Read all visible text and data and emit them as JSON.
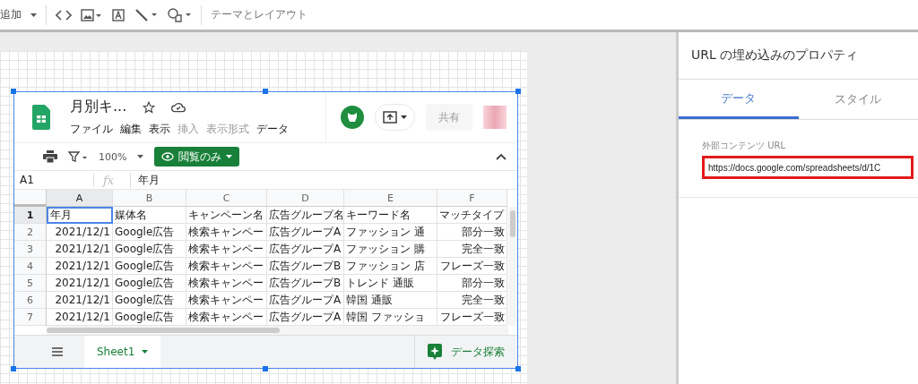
{
  "toolbar": {
    "add_label": "追加",
    "theme_button": "テーマとレイアウト"
  },
  "sheet": {
    "title": "月別キ...",
    "menu": [
      {
        "label": "ファイル",
        "disabled": false
      },
      {
        "label": "編集",
        "disabled": false
      },
      {
        "label": "表示",
        "disabled": false
      },
      {
        "label": "挿入",
        "disabled": true
      },
      {
        "label": "表示形式",
        "disabled": true
      },
      {
        "label": "データ",
        "disabled": false
      }
    ],
    "share_button": {
      "label": "共有",
      "disabled": true
    },
    "zoom": "100%",
    "view_mode": "閲覧のみ",
    "cell_ref": "A1",
    "function_label": "fx",
    "formula": "年月",
    "columns": [
      {
        "label": "A",
        "selected": true,
        "right_aligned": true
      },
      {
        "label": "B",
        "selected": false,
        "right_aligned": false
      },
      {
        "label": "C",
        "selected": false,
        "right_aligned": false
      },
      {
        "label": "D",
        "selected": false,
        "right_aligned": false
      },
      {
        "label": "E",
        "selected": false,
        "right_aligned": false
      },
      {
        "label": "F",
        "selected": false,
        "right_aligned": true
      }
    ],
    "rows": [
      {
        "number": "1",
        "kind": "header",
        "selected": true,
        "cells": [
          "年月",
          "媒体名",
          "キャンペーン名",
          "広告グループ名",
          "キーワード名",
          "マッチタイプ"
        ]
      },
      {
        "number": "2",
        "kind": "data",
        "selected": false,
        "cells": [
          "2021/12/1",
          "Google広告",
          "検索キャンペー",
          "広告グループA",
          "ファッション 通",
          "部分一致"
        ]
      },
      {
        "number": "3",
        "kind": "data",
        "selected": false,
        "cells": [
          "2021/12/1",
          "Google広告",
          "検索キャンペー",
          "広告グループA",
          "ファッション 購",
          "完全一致"
        ]
      },
      {
        "number": "4",
        "kind": "data",
        "selected": false,
        "cells": [
          "2021/12/1",
          "Google広告",
          "検索キャンペー",
          "広告グループB",
          "ファッション 店",
          "フレーズ一致"
        ]
      },
      {
        "number": "5",
        "kind": "data",
        "selected": false,
        "cells": [
          "2021/12/1",
          "Google広告",
          "検索キャンペー",
          "広告グループB",
          "トレンド 通販",
          "部分一致"
        ]
      },
      {
        "number": "6",
        "kind": "data",
        "selected": false,
        "cells": [
          "2021/12/1",
          "Google広告",
          "検索キャンペー",
          "広告グループA",
          "韓国 通販",
          "完全一致"
        ]
      },
      {
        "number": "7",
        "kind": "data",
        "selected": false,
        "cells": [
          "2021/12/1",
          "Google広告",
          "検索キャンペー",
          "広告グループA",
          "韓国 ファッショ",
          "フレーズ一致"
        ]
      }
    ],
    "sheet_tabs": [
      {
        "label": "Sheet1",
        "selected": true
      }
    ],
    "explore_button": "データ探索"
  },
  "panel": {
    "title": "URL の埋め込みのプロパティ",
    "tabs": [
      {
        "label": "データ",
        "selected": true
      },
      {
        "label": "スタイル",
        "selected": false
      }
    ],
    "url_field": {
      "label": "外部コンテンツ URL",
      "value": "https://docs.google.com/spreadsheets/d/1C",
      "highlighted": true
    }
  }
}
